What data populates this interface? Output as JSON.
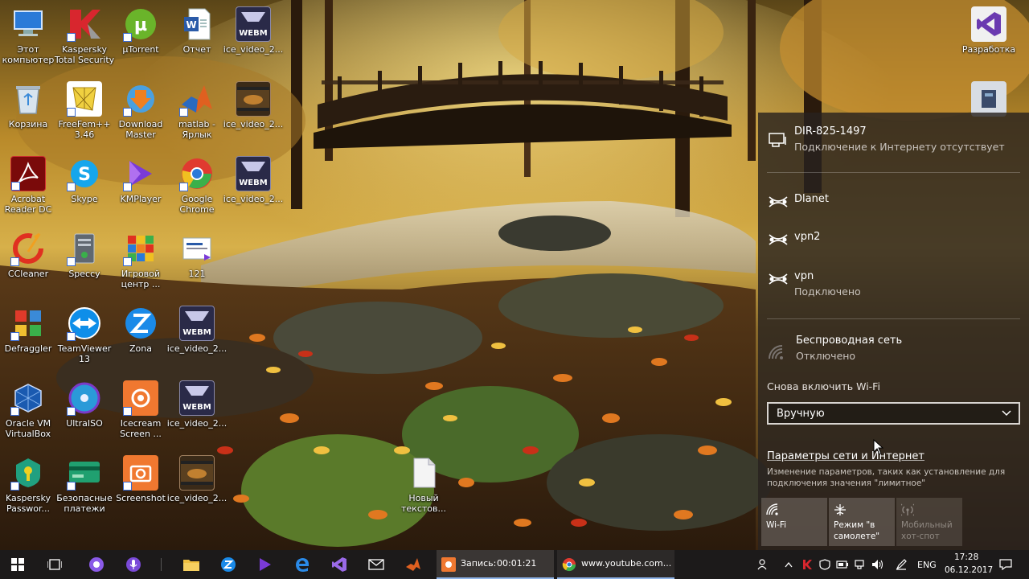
{
  "desktop": {
    "icons": [
      {
        "label": "Этот\nкомпьютер",
        "icon": "computer-icon"
      },
      {
        "label": "Kaspersky\nTotal Security",
        "icon": "kaspersky-icon"
      },
      {
        "label": "µTorrent",
        "icon": "utorrent-icon"
      },
      {
        "label": "Отчет",
        "icon": "word-document-icon"
      },
      {
        "label": "ice_video_2...",
        "icon": "webm-file-icon",
        "badge": "WEBM"
      },
      {
        "label": "Корзина",
        "icon": "recycle-bin-icon"
      },
      {
        "label": "FreeFem++\n3.46",
        "icon": "freefem-icon"
      },
      {
        "label": "Download\nMaster",
        "icon": "download-master-icon"
      },
      {
        "label": "matlab -\nЯрлык",
        "icon": "matlab-icon"
      },
      {
        "label": "ice_video_2...",
        "icon": "video-thumbnail-icon"
      },
      {
        "label": "Acrobat\nReader DC",
        "icon": "acrobat-icon"
      },
      {
        "label": "Skype",
        "icon": "skype-icon"
      },
      {
        "label": "KMPlayer",
        "icon": "kmplayer-icon"
      },
      {
        "label": "Google\nChrome",
        "icon": "chrome-icon"
      },
      {
        "label": "ice_video_2...",
        "icon": "webm-file-icon",
        "badge": "WEBM"
      },
      {
        "label": "CCleaner",
        "icon": "ccleaner-icon"
      },
      {
        "label": "Speccy",
        "icon": "speccy-icon"
      },
      {
        "label": "Игровой\nцентр ...",
        "icon": "game-center-icon"
      },
      {
        "label": "121",
        "icon": "image-file-icon"
      },
      {
        "label": "Defraggler",
        "icon": "defraggler-icon"
      },
      {
        "label": "TeamViewer\n13",
        "icon": "teamviewer-icon"
      },
      {
        "label": "Zona",
        "icon": "zona-icon"
      },
      {
        "label": "ice_video_2...",
        "icon": "webm-file-icon",
        "badge": "WEBM"
      },
      {
        "label": "Oracle VM\nVirtualBox",
        "icon": "virtualbox-icon"
      },
      {
        "label": "UltraISO",
        "icon": "ultraiso-icon"
      },
      {
        "label": "Icecream\nScreen ...",
        "icon": "icecream-icon"
      },
      {
        "label": "ice_video_2...",
        "icon": "webm-file-icon",
        "badge": "WEBM"
      },
      {
        "label": "Kaspersky\nPasswor...",
        "icon": "kaspersky-password-icon"
      },
      {
        "label": "Безопасные\nплатежи",
        "icon": "safe-payments-icon"
      },
      {
        "label": "Screenshot",
        "icon": "screenshot-icon"
      },
      {
        "label": "ice_video_2...",
        "icon": "video-thumbnail-icon"
      },
      {
        "label": "Новый\nтекстов...",
        "icon": "text-document-icon"
      },
      {
        "label": "Разработка",
        "icon": "visual-studio-icon"
      },
      {
        "label": "",
        "icon": "app-shortcut-icon"
      }
    ]
  },
  "flyout": {
    "networks": [
      {
        "name": "DIR-825-1497",
        "status": "Подключение к Интернету отсутствует",
        "icon": "ethernet-icon"
      },
      {
        "name": "Dlanet",
        "status": "",
        "icon": "dialup-icon"
      },
      {
        "name": "vpn2",
        "status": "",
        "icon": "dialup-icon"
      },
      {
        "name": "vpn",
        "status": "Подключено",
        "icon": "dialup-icon"
      },
      {
        "name": "Беспроводная сеть",
        "status": "Отключено",
        "icon": "wifi-off-icon"
      }
    ],
    "reenable_label": "Снова включить Wi-Fi",
    "reenable_value": "Вручную",
    "settings_link": "Параметры сети и Интернет",
    "settings_desc": "Изменение параметров, таких как установление для подключения значения \"лимитное\"",
    "quick_actions": [
      {
        "label": "Wi-Fi",
        "icon": "wifi-icon",
        "enabled": true
      },
      {
        "label": "Режим \"в\nсамолете\"",
        "icon": "airplane-icon",
        "enabled": true
      },
      {
        "label": "Мобильный\nхот-спот",
        "icon": "hotspot-icon",
        "enabled": false
      }
    ]
  },
  "taskbar": {
    "recording_label": "Запись:",
    "recording_time": "00:01:21",
    "browser_label": "www.youtube.com...",
    "language": "ENG",
    "time": "17:28",
    "date": "06.12.2017"
  }
}
